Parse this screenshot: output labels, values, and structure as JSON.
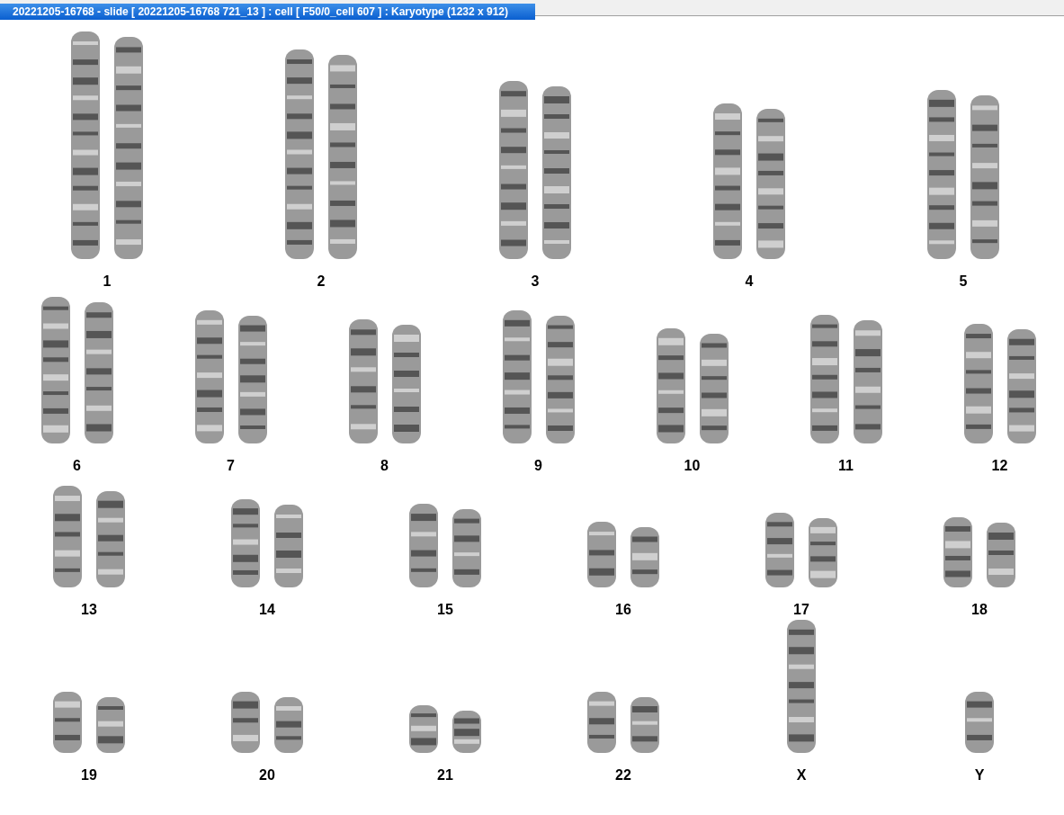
{
  "window": {
    "title": "20221205-16768 - slide [ 20221205-16768 721_13 ] : cell [ F50/0_cell 607 ] : Karyotype  (1232 x 912)"
  },
  "karyotype": {
    "rows": [
      [
        {
          "label": "1",
          "kind": "pair"
        },
        {
          "label": "2",
          "kind": "pair"
        },
        {
          "label": "3",
          "kind": "pair"
        },
        {
          "label": "4",
          "kind": "pair"
        },
        {
          "label": "5",
          "kind": "pair"
        }
      ],
      [
        {
          "label": "6",
          "kind": "pair"
        },
        {
          "label": "7",
          "kind": "pair"
        },
        {
          "label": "8",
          "kind": "pair"
        },
        {
          "label": "9",
          "kind": "pair"
        },
        {
          "label": "10",
          "kind": "pair"
        },
        {
          "label": "11",
          "kind": "pair"
        },
        {
          "label": "12",
          "kind": "pair"
        }
      ],
      [
        {
          "label": "13",
          "kind": "pair"
        },
        {
          "label": "14",
          "kind": "pair"
        },
        {
          "label": "15",
          "kind": "pair"
        },
        {
          "label": "16",
          "kind": "pair"
        },
        {
          "label": "17",
          "kind": "pair"
        },
        {
          "label": "18",
          "kind": "pair"
        }
      ],
      [
        {
          "label": "19",
          "kind": "pair"
        },
        {
          "label": "20",
          "kind": "pair"
        },
        {
          "label": "21",
          "kind": "pair"
        },
        {
          "label": "22",
          "kind": "pair"
        },
        {
          "label": "X",
          "kind": "single"
        },
        {
          "label": "Y",
          "kind": "single"
        }
      ]
    ]
  }
}
